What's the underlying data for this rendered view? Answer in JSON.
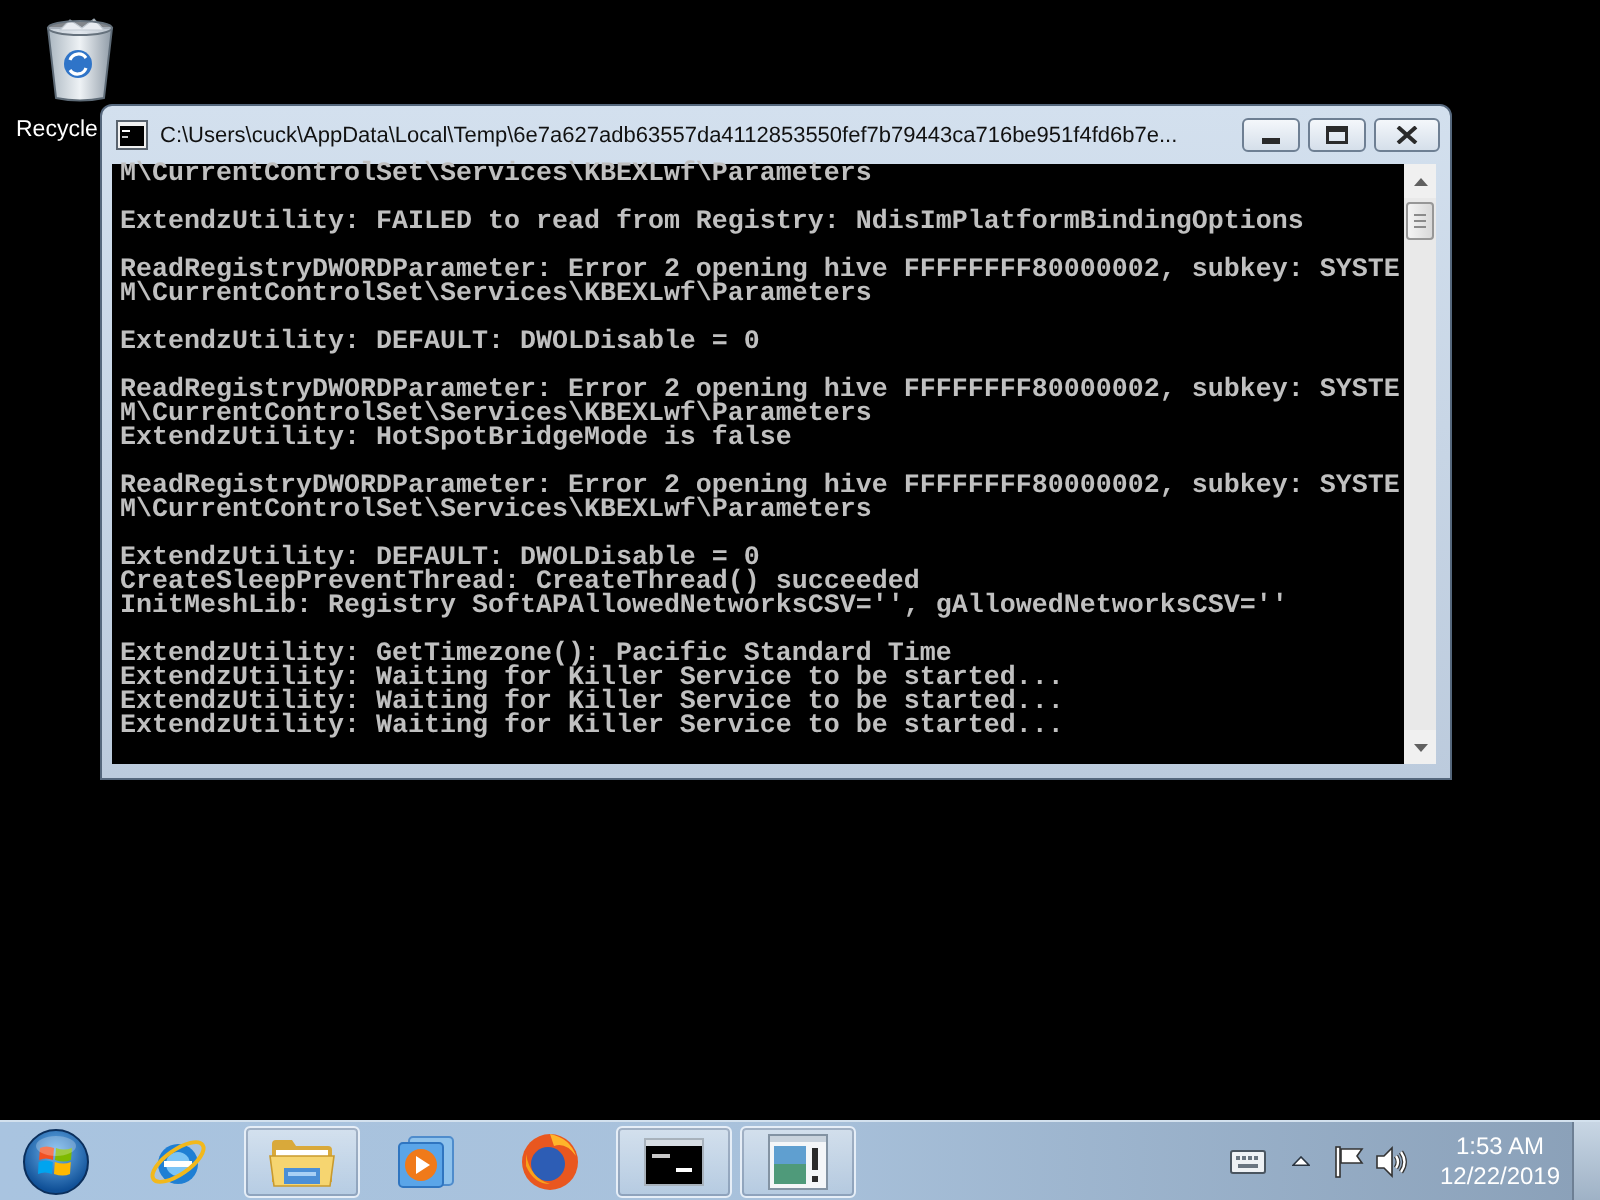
{
  "desktop": {
    "icons": [
      {
        "label": "Recycle"
      }
    ]
  },
  "window": {
    "title": "C:\\Users\\cuck\\AppData\\Local\\Temp\\6e7a627adb63557da4112853550fef7b79443ca716be951f4fd6b7e...",
    "console": {
      "blocks": [
        [
          "M\\CurrentControlSet\\Services\\KBEXLwf\\Parameters"
        ],
        [
          "ExtendzUtility: FAILED to read from Registry: NdisImPlatformBindingOptions"
        ],
        [
          "ReadRegistryDWORDParameter: Error 2 opening hive FFFFFFFF80000002, subkey: SYSTE",
          "M\\CurrentControlSet\\Services\\KBEXLwf\\Parameters"
        ],
        [
          "ExtendzUtility: DEFAULT: DWOLDisable = 0"
        ],
        [
          "ReadRegistryDWORDParameter: Error 2 opening hive FFFFFFFF80000002, subkey: SYSTE",
          "M\\CurrentControlSet\\Services\\KBEXLwf\\Parameters",
          "ExtendzUtility: HotSpotBridgeMode is false"
        ],
        [
          "ReadRegistryDWORDParameter: Error 2 opening hive FFFFFFFF80000002, subkey: SYSTE",
          "M\\CurrentControlSet\\Services\\KBEXLwf\\Parameters"
        ],
        [
          "ExtendzUtility: DEFAULT: DWOLDisable = 0",
          "CreateSleepPreventThread: CreateThread() succeeded",
          "InitMeshLib: Registry SoftAPAllowedNetworksCSV='', gAllowedNetworksCSV=''"
        ],
        [
          "ExtendzUtility: GetTimezone(): Pacific Standard Time",
          "ExtendzUtility: Waiting for Killer Service to be started...",
          "ExtendzUtility: Waiting for Killer Service to be started...",
          "ExtendzUtility: Waiting for Killer Service to be started..."
        ]
      ]
    }
  },
  "taskbar": {
    "buttons": [
      {
        "kind": "ebrowser",
        "running": false
      },
      {
        "kind": "folders",
        "running": true
      },
      {
        "kind": "player",
        "running": false
      },
      {
        "kind": "foxbrowser",
        "running": false
      },
      {
        "kind": "console",
        "running": true
      },
      {
        "kind": "panel",
        "running": true
      }
    ],
    "clock": {
      "time": "1:53 AM",
      "date": "12/22/2019"
    }
  }
}
